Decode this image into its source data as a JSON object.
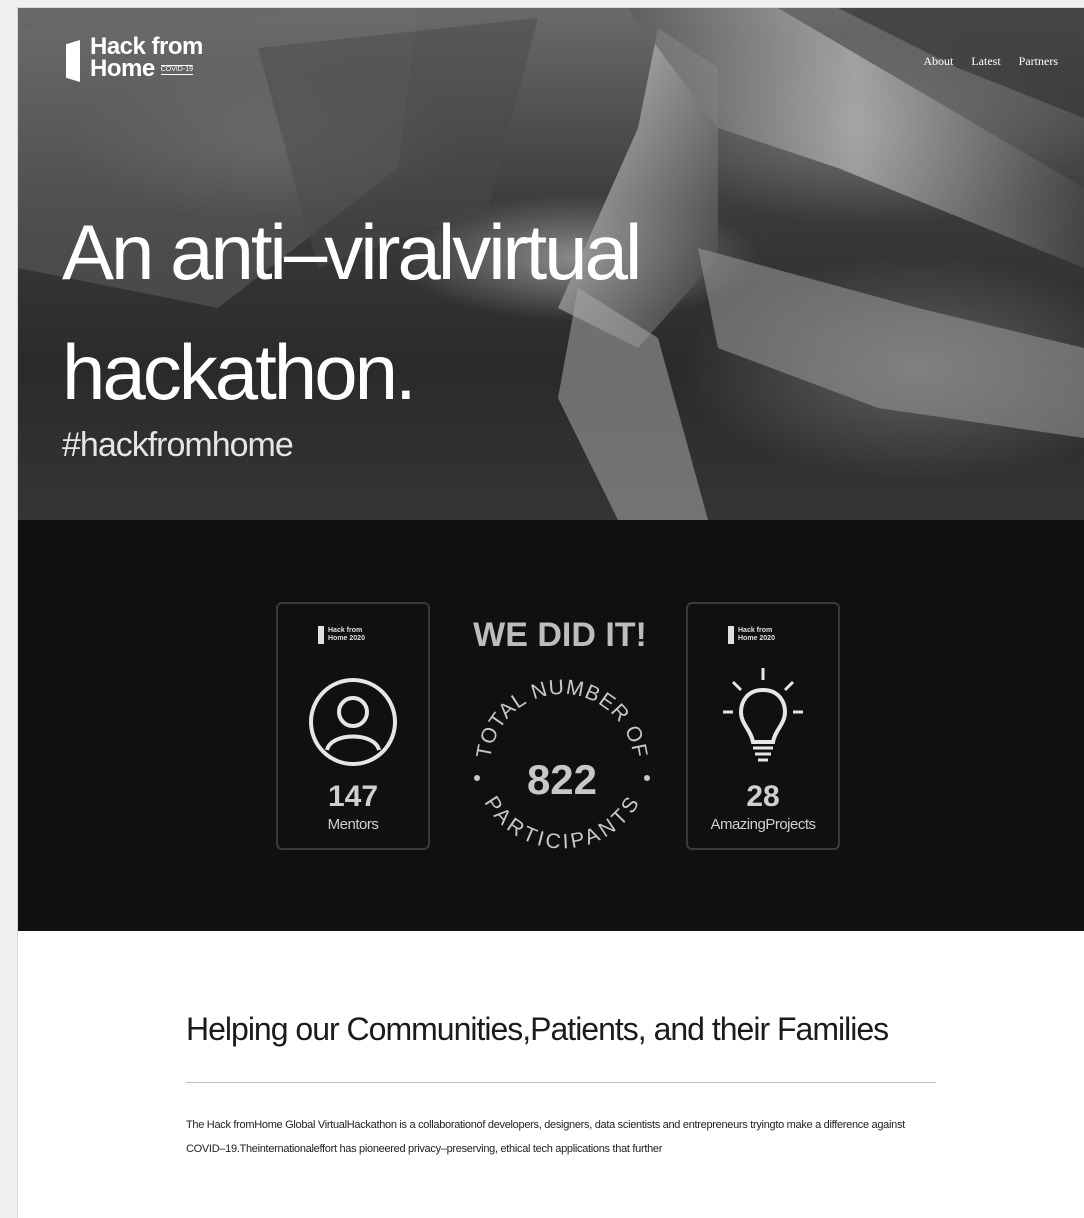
{
  "brand": {
    "line1": "Hack from",
    "line2": "Home",
    "tag": "COVID-19"
  },
  "nav": {
    "items": [
      "About",
      "Latest",
      "Partners"
    ]
  },
  "hero": {
    "title_line1": "An anti–viralvirtual",
    "title_line2": "hackathon.",
    "hashtag": "#hackfromhome"
  },
  "stats": {
    "card_logo_line1": "Hack from",
    "card_logo_line2": "Home 2020",
    "mentors": {
      "value": "147",
      "label": "Mentors",
      "icon": "person-icon"
    },
    "center": {
      "headline": "WE DID IT!",
      "arc_top": "TOTAL NUMBER OF",
      "arc_bottom": "PARTICIPANTS",
      "value": "822"
    },
    "projects": {
      "value": "28",
      "label": "AmazingProjects",
      "icon": "lightbulb-icon"
    }
  },
  "section": {
    "heading": "Helping our Communities,Patients, and their Families",
    "body": "The Hack fromHome Global VirtualHackathon is a collaborationof developers, designers, data scientists and entrepreneurs tryingto make a difference against COVID–19.Theinternationaleffort has pioneered privacy–preserving, ethical tech applications that further"
  },
  "colors": {
    "stats_bg": "#101010",
    "hero_text": "#ffffff",
    "page_bg": "#ffffff"
  }
}
